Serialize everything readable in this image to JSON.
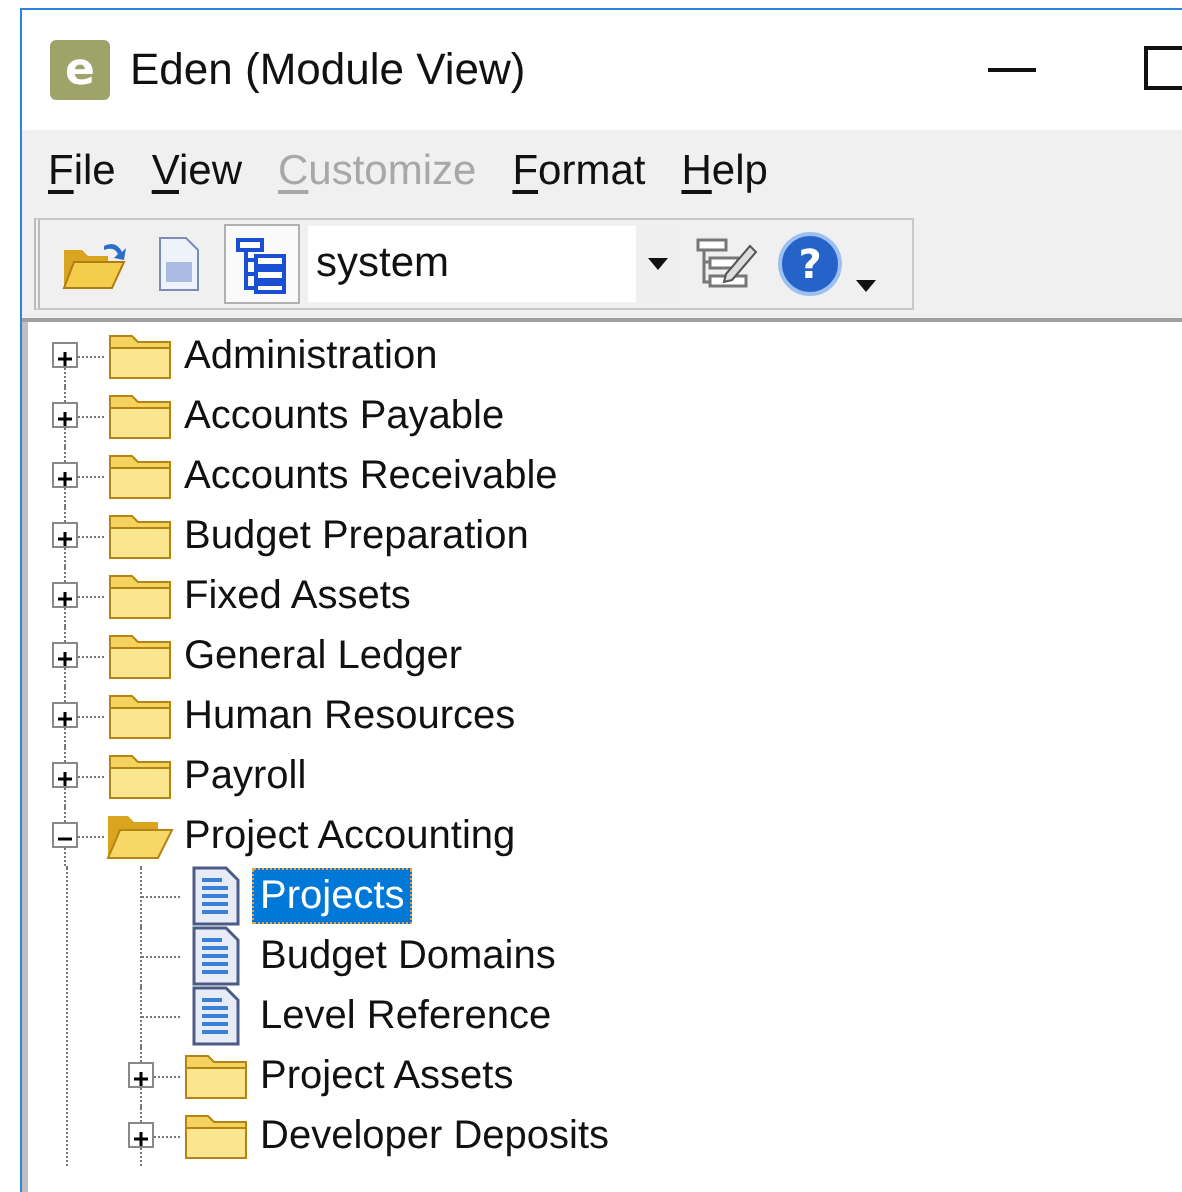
{
  "window": {
    "logo_letter": "e",
    "title": "Eden (Module View)"
  },
  "menu": [
    {
      "label": "File",
      "disabled": false
    },
    {
      "label": "View",
      "disabled": false
    },
    {
      "label": "Customize",
      "disabled": true
    },
    {
      "label": "Format",
      "disabled": false
    },
    {
      "label": "Help",
      "disabled": false
    }
  ],
  "toolbar": {
    "items": [
      {
        "kind": "open",
        "selected": false
      },
      {
        "kind": "new",
        "selected": false
      },
      {
        "kind": "tree",
        "selected": true
      },
      {
        "kind": "combo",
        "value": "system"
      },
      {
        "kind": "properties",
        "selected": false
      },
      {
        "kind": "help",
        "glyph": "?",
        "selected": false
      },
      {
        "kind": "overflow"
      }
    ]
  },
  "tree": [
    {
      "label": "Administration",
      "kind": "folder",
      "expanded": false,
      "selected": false
    },
    {
      "label": "Accounts Payable",
      "kind": "folder",
      "expanded": false,
      "selected": false
    },
    {
      "label": "Accounts Receivable",
      "kind": "folder",
      "expanded": false,
      "selected": false
    },
    {
      "label": "Budget Preparation",
      "kind": "folder",
      "expanded": false,
      "selected": false
    },
    {
      "label": "Fixed Assets",
      "kind": "folder",
      "expanded": false,
      "selected": false
    },
    {
      "label": "General Ledger",
      "kind": "folder",
      "expanded": false,
      "selected": false
    },
    {
      "label": "Human Resources",
      "kind": "folder",
      "expanded": false,
      "selected": false
    },
    {
      "label": "Payroll",
      "kind": "folder",
      "expanded": false,
      "selected": false
    },
    {
      "label": "Project Accounting",
      "kind": "folder",
      "expanded": true,
      "selected": false,
      "children": [
        {
          "label": "Projects",
          "kind": "document",
          "selected": true
        },
        {
          "label": "Budget Domains",
          "kind": "document",
          "selected": false
        },
        {
          "label": "Level Reference",
          "kind": "document",
          "selected": false
        },
        {
          "label": "Project Assets",
          "kind": "folder",
          "expanded": false,
          "selected": false
        },
        {
          "label": "Developer Deposits",
          "kind": "folder",
          "expanded": false,
          "selected": false
        }
      ]
    }
  ]
}
